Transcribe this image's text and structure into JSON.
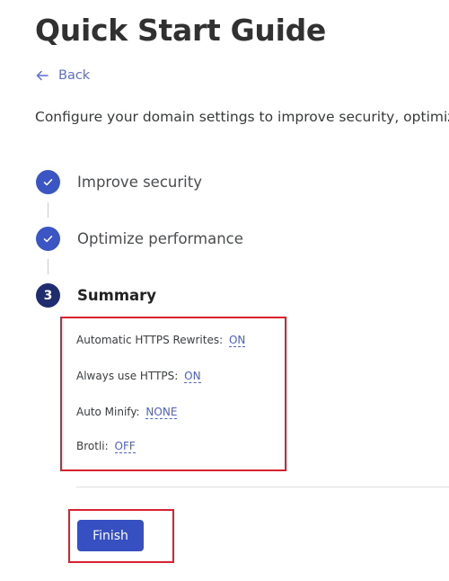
{
  "page": {
    "title": "Quick Start Guide",
    "back_label": "Back",
    "intro": "Configure your domain settings to improve security, optimiz"
  },
  "steps": [
    {
      "label": "Improve security",
      "status": "complete",
      "icon": "check-icon"
    },
    {
      "label": "Optimize performance",
      "status": "complete",
      "icon": "check-icon"
    },
    {
      "label": "Summary",
      "status": "current",
      "number": "3"
    }
  ],
  "summary": {
    "settings": [
      {
        "label": "Automatic HTTPS Rewrites:",
        "value": "ON"
      },
      {
        "label": "Always use HTTPS:",
        "value": "ON"
      },
      {
        "label": "Auto Minify:",
        "value": "NONE"
      },
      {
        "label": "Brotli:",
        "value": "OFF"
      }
    ]
  },
  "actions": {
    "finish_label": "Finish"
  },
  "colors": {
    "accent": "#3650c2",
    "link": "#5a6fd6",
    "current_step": "#1f2c70",
    "highlight_border": "#d8222f"
  }
}
